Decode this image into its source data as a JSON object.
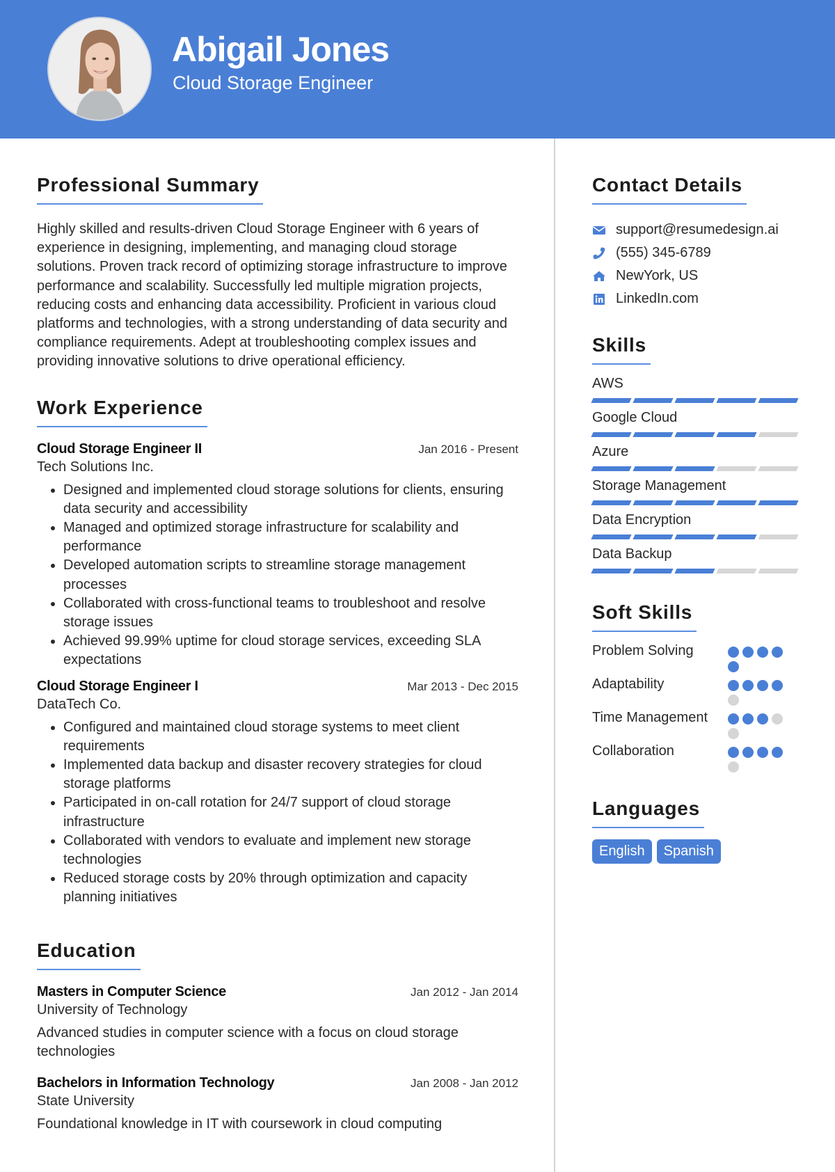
{
  "header": {
    "name": "Abigail Jones",
    "title": "Cloud Storage Engineer"
  },
  "colors": {
    "accent": "#4a7fd6",
    "inactive": "#d6d6d6"
  },
  "summary": {
    "heading": "Professional Summary",
    "text": "Highly skilled and results-driven Cloud Storage Engineer with 6 years of experience in designing, implementing, and managing cloud storage solutions. Proven track record of optimizing storage infrastructure to improve performance and scalability. Successfully led multiple migration projects, reducing costs and enhancing data accessibility. Proficient in various cloud platforms and technologies, with a strong understanding of data security and compliance requirements. Adept at troubleshooting complex issues and providing innovative solutions to drive operational efficiency."
  },
  "experience": {
    "heading": "Work Experience",
    "jobs": [
      {
        "role": "Cloud Storage Engineer II",
        "company": "Tech Solutions Inc.",
        "dates": "Jan 2016 - Present",
        "bullets": [
          "Designed and implemented cloud storage solutions for clients, ensuring data security and accessibility",
          "Managed and optimized storage infrastructure for scalability and performance",
          "Developed automation scripts to streamline storage management processes",
          "Collaborated with cross-functional teams to troubleshoot and resolve storage issues",
          "Achieved 99.99% uptime for cloud storage services, exceeding SLA expectations"
        ]
      },
      {
        "role": "Cloud Storage Engineer I",
        "company": "DataTech Co.",
        "dates": "Mar 2013 - Dec 2015",
        "bullets": [
          "Configured and maintained cloud storage systems to meet client requirements",
          "Implemented data backup and disaster recovery strategies for cloud storage platforms",
          "Participated in on-call rotation for 24/7 support of cloud storage infrastructure",
          "Collaborated with vendors to evaluate and implement new storage technologies",
          "Reduced storage costs by 20% through optimization and capacity planning initiatives"
        ]
      }
    ]
  },
  "education": {
    "heading": "Education",
    "items": [
      {
        "degree": "Masters in Computer Science",
        "school": "University of Technology",
        "dates": "Jan 2012 - Jan 2014",
        "description": "Advanced studies in computer science with a focus on cloud storage technologies"
      },
      {
        "degree": "Bachelors in Information Technology",
        "school": "State University",
        "dates": "Jan 2008 - Jan 2012",
        "description": "Foundational knowledge in IT with coursework in cloud computing"
      }
    ]
  },
  "contact": {
    "heading": "Contact Details",
    "items": [
      {
        "icon": "envelope-icon",
        "text": "support@resumedesign.ai"
      },
      {
        "icon": "phone-icon",
        "text": "(555) 345-6789"
      },
      {
        "icon": "home-icon",
        "text": "NewYork, US"
      },
      {
        "icon": "linkedin-icon",
        "text": "LinkedIn.com"
      }
    ]
  },
  "skills": {
    "heading": "Skills",
    "max": 5,
    "items": [
      {
        "name": "AWS",
        "level": 5
      },
      {
        "name": "Google Cloud",
        "level": 4
      },
      {
        "name": "Azure",
        "level": 3
      },
      {
        "name": "Storage Management",
        "level": 5
      },
      {
        "name": "Data Encryption",
        "level": 4
      },
      {
        "name": "Data Backup",
        "level": 3
      }
    ]
  },
  "soft_skills": {
    "heading": "Soft Skills",
    "max": 5,
    "items": [
      {
        "name": "Problem Solving",
        "level": 5
      },
      {
        "name": "Adaptability",
        "level": 4
      },
      {
        "name": "Time Management",
        "level": 3
      },
      {
        "name": "Collaboration",
        "level": 4
      }
    ]
  },
  "languages": {
    "heading": "Languages",
    "items": [
      "English",
      "Spanish"
    ]
  }
}
